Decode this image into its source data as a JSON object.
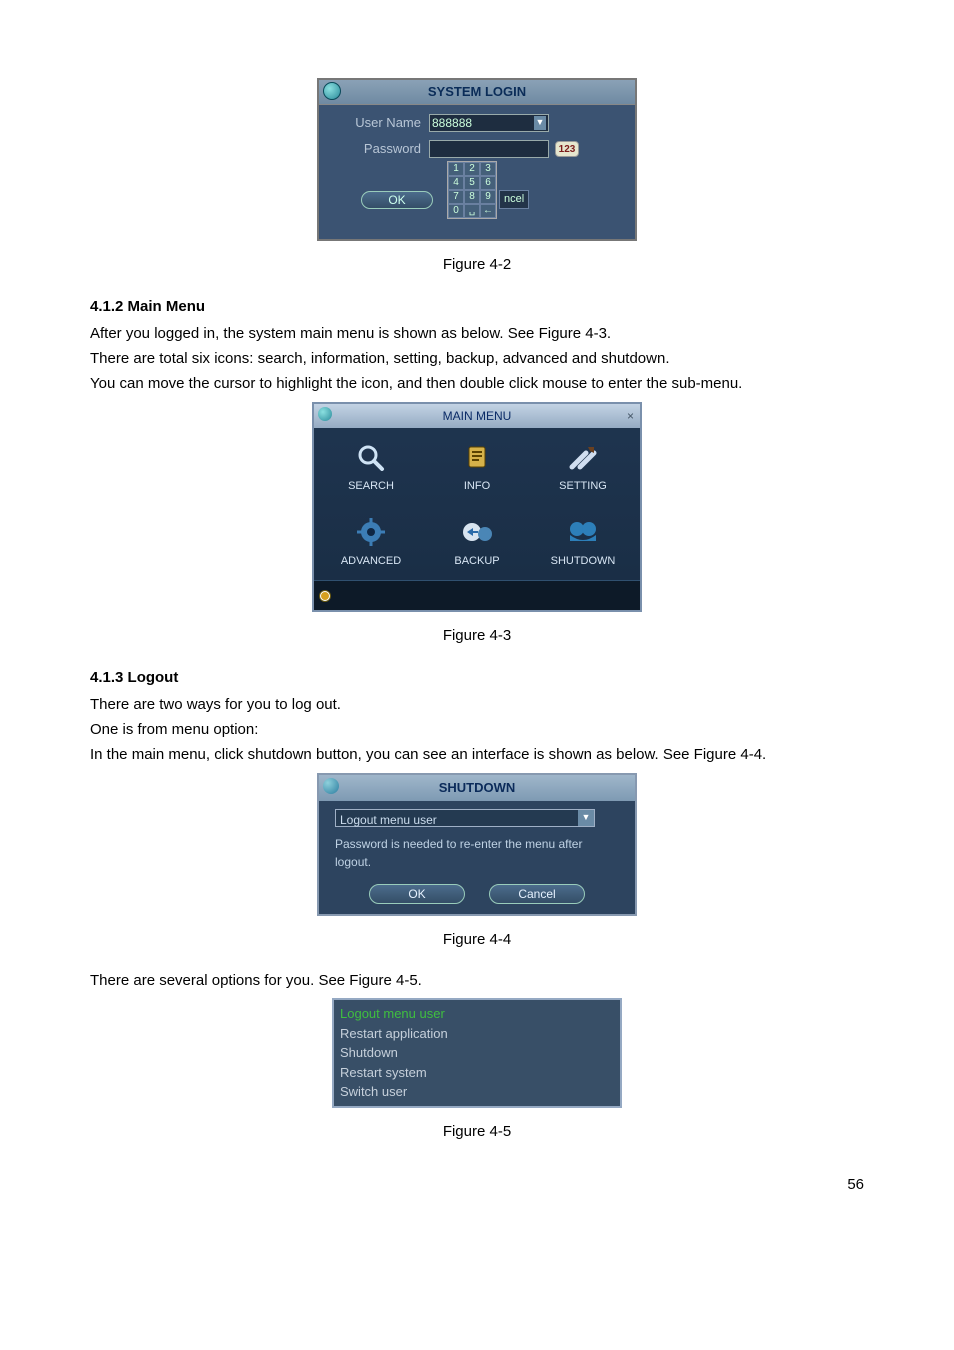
{
  "fig42": {
    "title": "SYSTEM LOGIN",
    "username_label": "User Name",
    "username_value": "888888",
    "password_label": "Password",
    "input_mode_badge": "123",
    "keypad": [
      "1",
      "2",
      "3",
      "4",
      "5",
      "6",
      "7",
      "8",
      "9",
      "0",
      "␣",
      "←"
    ],
    "keypad_overflow_text": "ncel",
    "ok_label": "OK",
    "caption": "Figure 4-2"
  },
  "section412": {
    "heading": "4.1.2   Main Menu",
    "p1": "After you logged in, the system main menu is shown as below. See Figure 4-3.",
    "p2": "There are total six icons: search, information, setting, backup, advanced and shutdown.",
    "p3": "You can move the cursor to highlight the icon, and then double click mouse to enter the sub-menu."
  },
  "fig43": {
    "title": "MAIN MENU",
    "items": [
      "SEARCH",
      "INFO",
      "SETTING",
      "ADVANCED",
      "BACKUP",
      "SHUTDOWN"
    ],
    "caption": "Figure 4-3"
  },
  "section413": {
    "heading": "4.1.3   Logout",
    "p1": "There are two ways for you to log out.",
    "p2": "One is from menu option:",
    "p3": "In the main menu, click shutdown button, you can see an interface is shown as below.  See Figure 4-4."
  },
  "fig44": {
    "title": "SHUTDOWN",
    "selected": "Logout menu user",
    "note": "Password is needed to re-enter the menu after logout.",
    "ok_label": "OK",
    "cancel_label": "Cancel",
    "caption": "Figure 4-4"
  },
  "after44": "There are several options for you. See Figure 4-5.",
  "fig45": {
    "options": [
      "Logout menu user",
      "Restart application",
      "Shutdown",
      "Restart system",
      "Switch user"
    ],
    "caption": "Figure 4-5"
  },
  "page_number": "56"
}
